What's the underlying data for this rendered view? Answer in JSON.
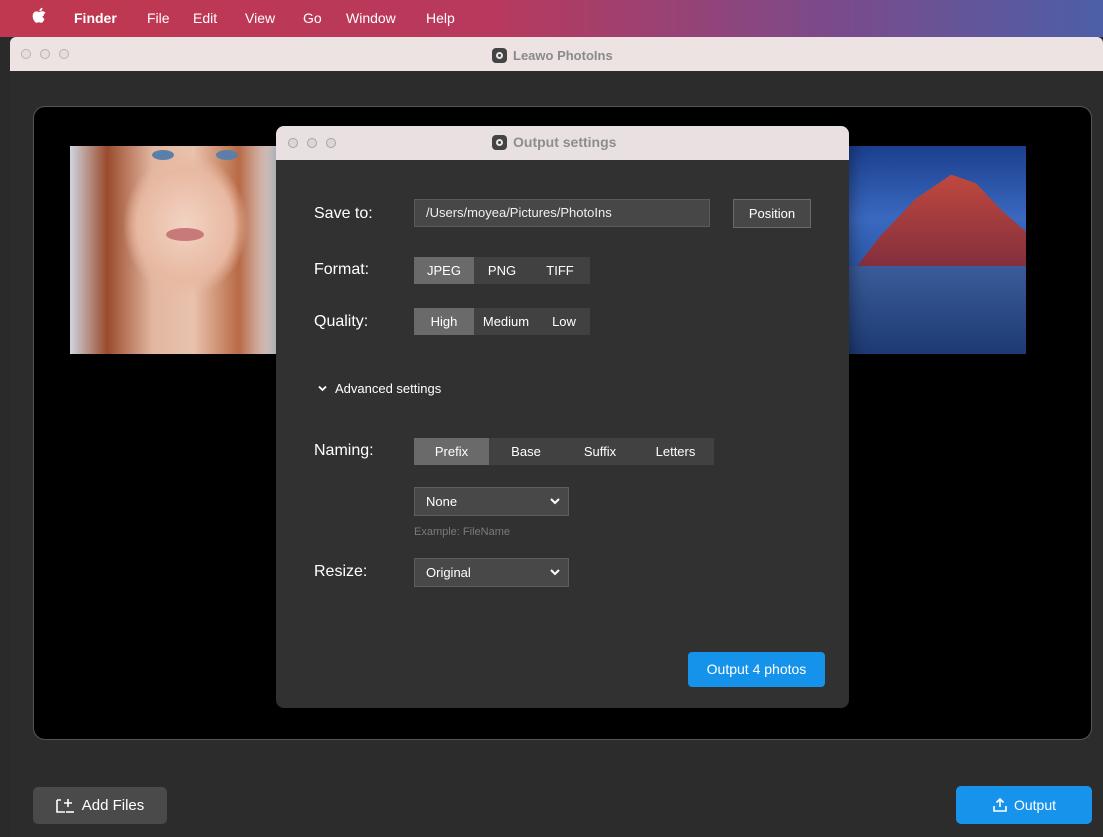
{
  "menubar": {
    "app": "Finder",
    "items": [
      "File",
      "Edit",
      "View",
      "Go",
      "Window",
      "Help"
    ]
  },
  "app": {
    "title": "Leawo PhotoIns"
  },
  "dialog": {
    "title": "Output settings",
    "save_to_label": "Save to:",
    "save_path": "/Users/moyea/Pictures/PhotoIns",
    "position_label": "Position",
    "format_label": "Format:",
    "formats": [
      "JPEG",
      "PNG",
      "TIFF"
    ],
    "format_selected": "JPEG",
    "quality_label": "Quality:",
    "qualities": [
      "High",
      "Medium",
      "Low"
    ],
    "quality_selected": "High",
    "advanced_label": "Advanced settings",
    "naming_label": "Naming:",
    "naming_options": [
      "Prefix",
      "Base",
      "Suffix",
      "Letters"
    ],
    "naming_selected": "Prefix",
    "prefix_value": "None",
    "example_text": "Example: FileName",
    "resize_label": "Resize:",
    "resize_value": "Original",
    "output_button": "Output 4 photos"
  },
  "footer": {
    "add_files_label": "Add Files",
    "output_label": "Output"
  },
  "colors": {
    "accent": "#1893ec",
    "dialog_bg": "#313131",
    "selected_segment": "#6a6a6a"
  }
}
